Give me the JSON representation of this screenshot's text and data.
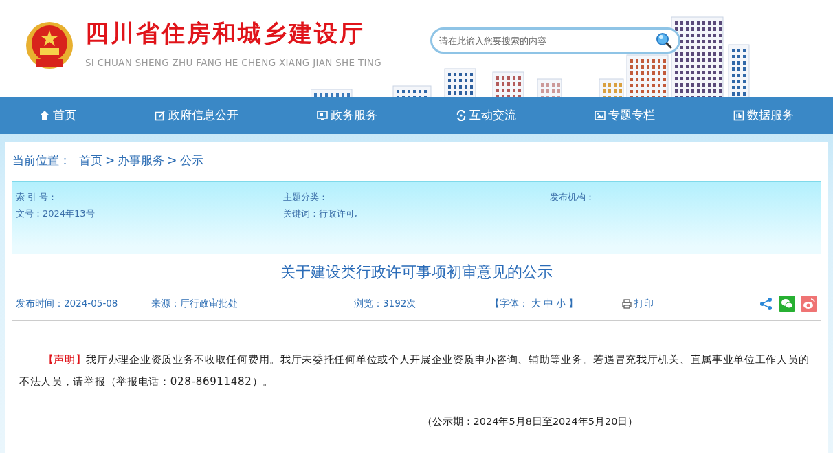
{
  "header": {
    "title": "四川省住房和城乡建设厅",
    "subtitle": "SI CHUAN SHENG ZHU FANG HE CHENG XIANG JIAN SHE TING",
    "search": {
      "placeholder": "请在此输入您要搜索的内容"
    }
  },
  "nav": [
    {
      "label": "首页"
    },
    {
      "label": "政府信息公开"
    },
    {
      "label": "政务服务"
    },
    {
      "label": "互动交流"
    },
    {
      "label": "专题专栏"
    },
    {
      "label": "数据服务"
    }
  ],
  "breadcrumb": {
    "label": "当前位置：",
    "items": [
      {
        "label": "首页"
      },
      {
        "label": "办事服务"
      },
      {
        "label": "公示"
      }
    ],
    "separator": ">"
  },
  "info": [
    {
      "label": "索 引 号："
    },
    {
      "label": "主题分类："
    },
    {
      "label": "发布机构："
    },
    {
      "label": "文号：",
      "value": "2024年13号"
    },
    {
      "label": "关键词：",
      "value": "行政许可,"
    }
  ],
  "article": {
    "title": "关于建设类行政许可事项初审意见的公示",
    "meta": {
      "date": "发布时间：2024-05-08",
      "source": "来源：厅行政审批处",
      "views": "浏览：3192次",
      "font_label": "【字体：",
      "font_sizes": [
        "大",
        "中",
        "小"
      ],
      "font_end": "】",
      "print": "打印"
    },
    "notice_label": "【声明】",
    "notice_text": "我厅办理企业资质业务不收取任何费用。我厅未委托任何单位或个人开展企业资质申办咨询、辅助等业务。若遇冒充我厅机关、直属事业单位工作人员的不法人员，请举报（举报电话：028-86911482）。",
    "period": "（公示期：2024年5月8日至2024年5月20日）"
  }
}
